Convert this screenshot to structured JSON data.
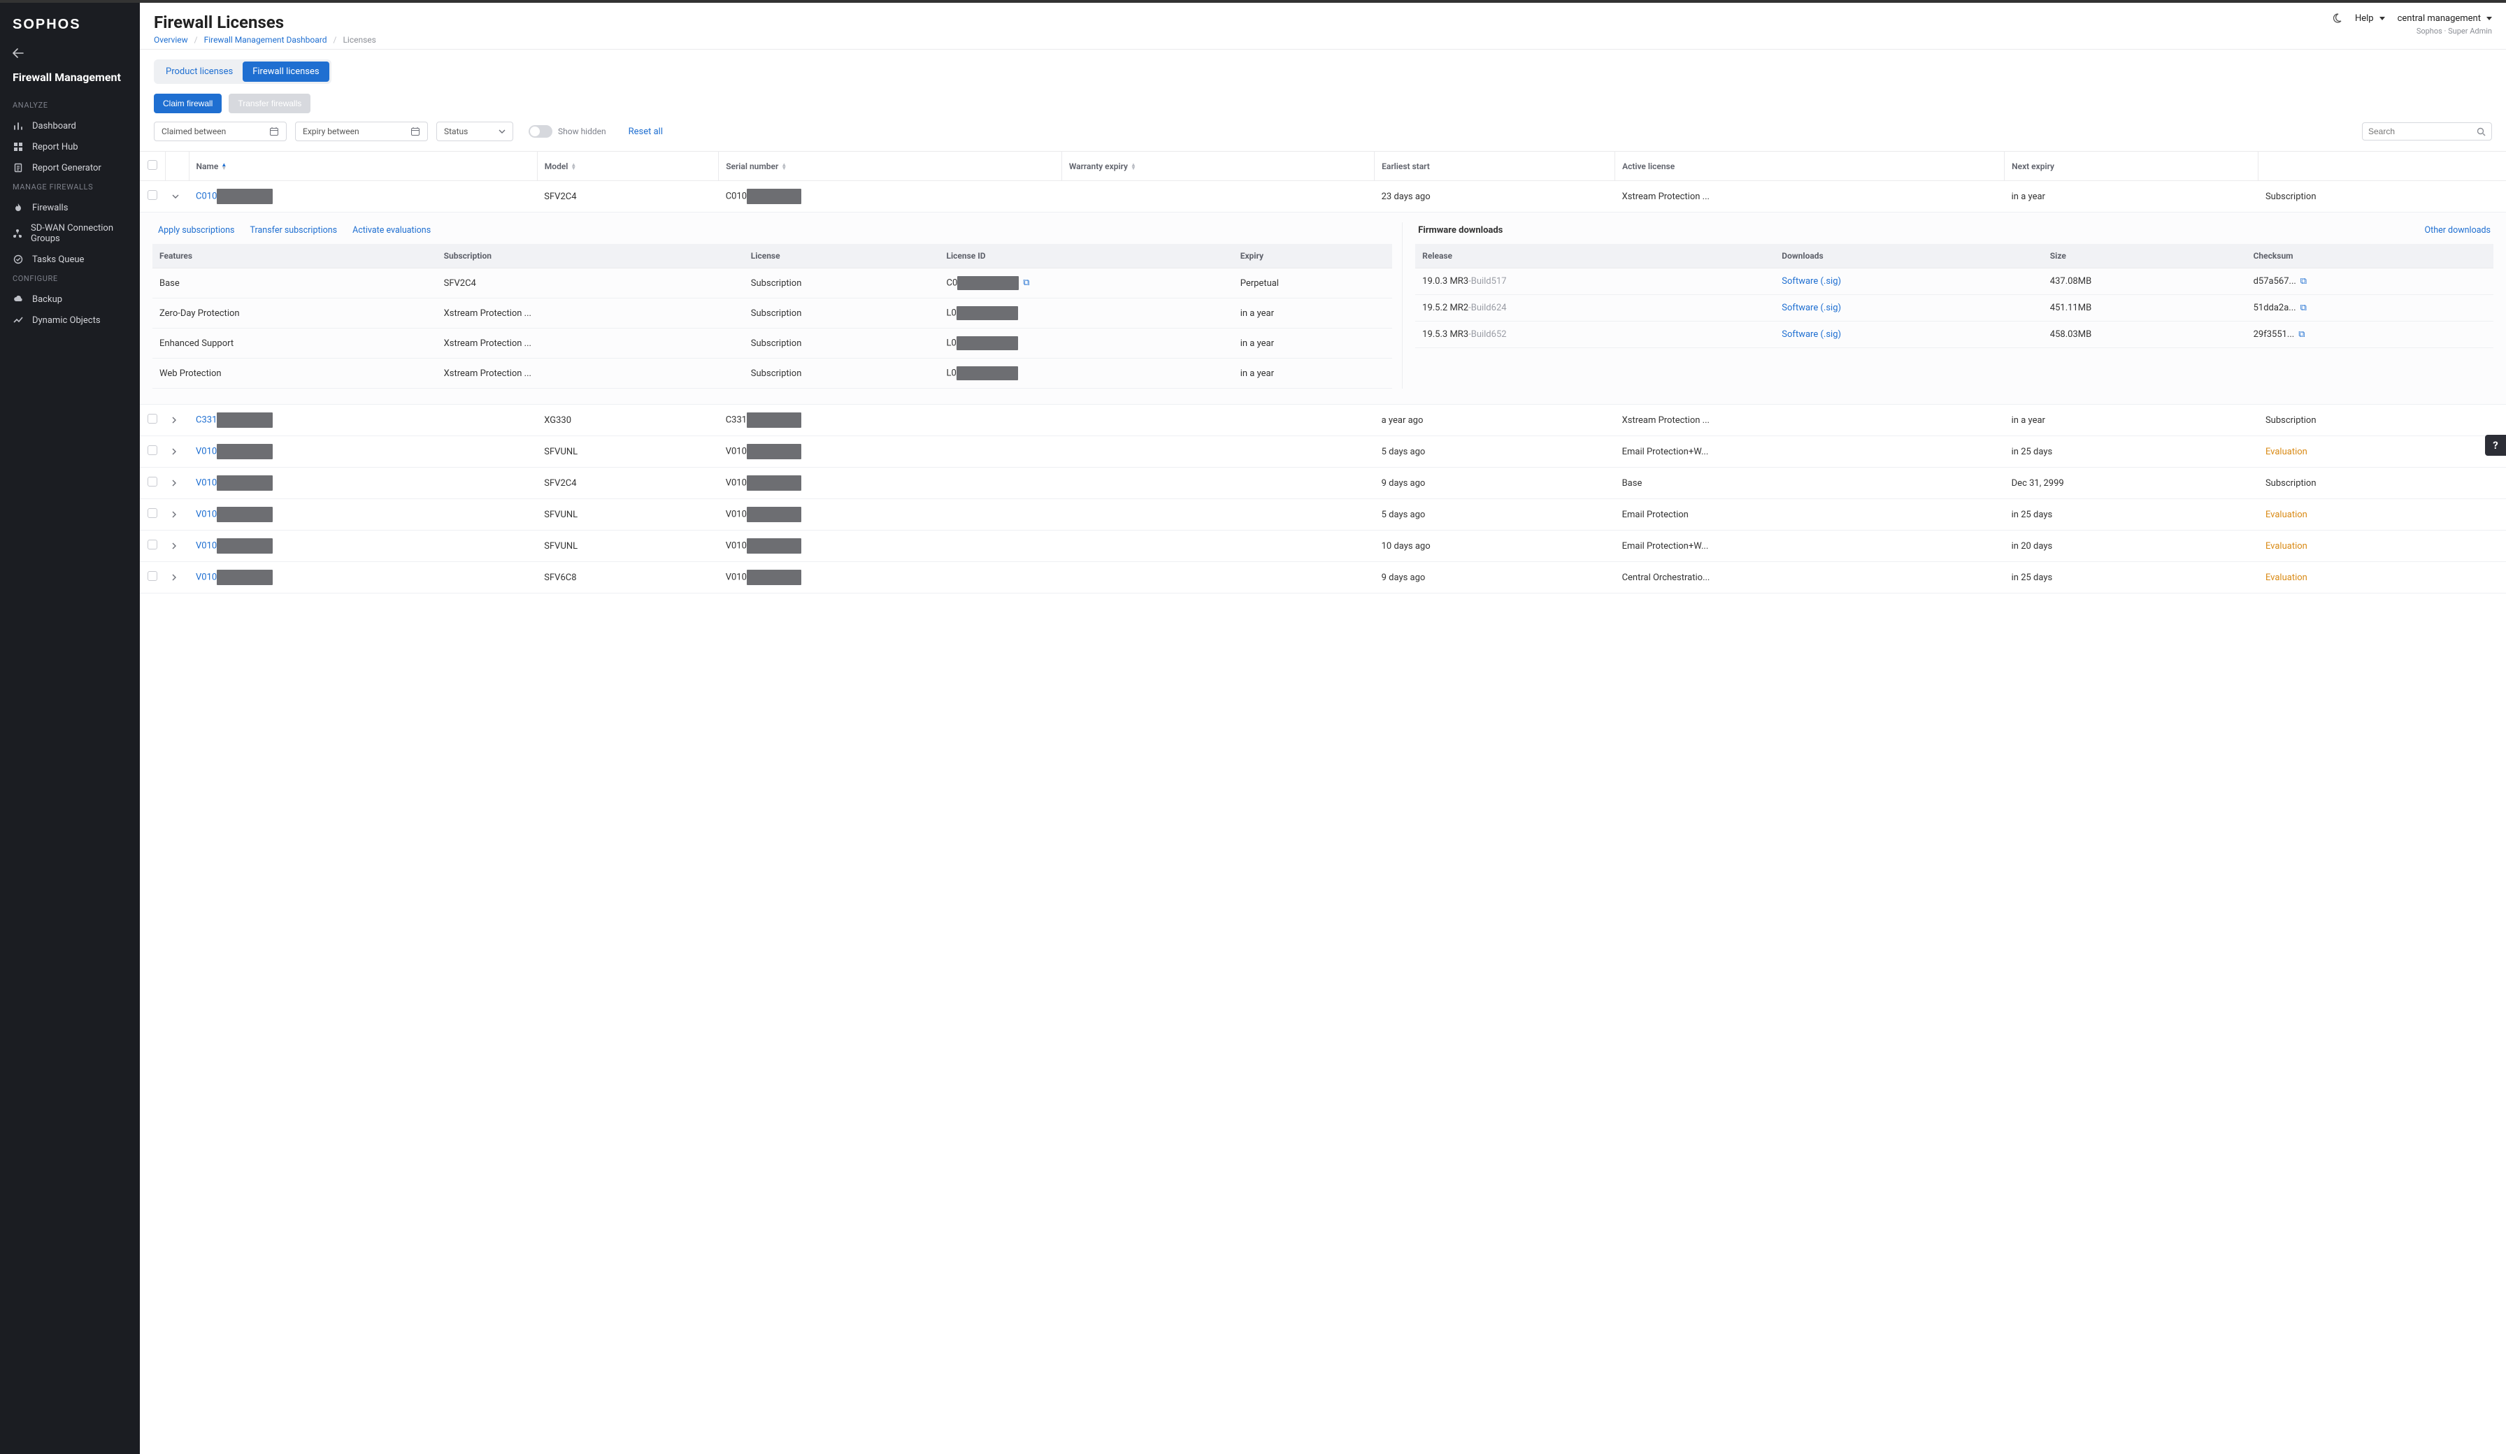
{
  "brand": "SOPHOS",
  "side_title": "Firewall Management",
  "side_groups": [
    {
      "label": "ANALYZE",
      "items": [
        {
          "id": "dashboard",
          "label": "Dashboard",
          "icon": "bars"
        },
        {
          "id": "report-hub",
          "label": "Report Hub",
          "icon": "grid"
        },
        {
          "id": "report-generator",
          "label": "Report Generator",
          "icon": "doc"
        }
      ]
    },
    {
      "label": "MANAGE FIREWALLS",
      "items": [
        {
          "id": "firewalls",
          "label": "Firewalls",
          "icon": "flame"
        },
        {
          "id": "sdwan",
          "label": "SD-WAN Connection Groups",
          "icon": "nodes"
        },
        {
          "id": "tasks",
          "label": "Tasks Queue",
          "icon": "check"
        }
      ]
    },
    {
      "label": "CONFIGURE",
      "items": [
        {
          "id": "backup",
          "label": "Backup",
          "icon": "cloud"
        },
        {
          "id": "dynamic",
          "label": "Dynamic Objects",
          "icon": "trend"
        }
      ]
    }
  ],
  "page_title": "Firewall Licenses",
  "crumbs": {
    "overview": "Overview",
    "dash": "Firewall Management Dashboard",
    "current": "Licenses"
  },
  "header": {
    "help": "Help",
    "account": "central management",
    "tenant": "Sophos · Super Admin"
  },
  "tabs": {
    "product": "Product licenses",
    "firewall": "Firewall licenses"
  },
  "actions": {
    "claim": "Claim firewall",
    "transfer": "Transfer firewalls"
  },
  "filters": {
    "claimed": "Claimed between",
    "expiry": "Expiry between",
    "status": "Status",
    "show_hidden": "Show hidden",
    "reset": "Reset all",
    "search_placeholder": "Search"
  },
  "columns": {
    "name": "Name",
    "model": "Model",
    "serial": "Serial number",
    "warranty": "Warranty expiry",
    "earliest": "Earliest start",
    "active": "Active license",
    "next": "Next expiry",
    "type_blank": ""
  },
  "rows": [
    {
      "expanded": true,
      "name_prefix": "C010",
      "model": "SFV2C4",
      "serial_prefix": "C010",
      "earliest": "23 days ago",
      "active": "Xstream Protection ...",
      "next": "in a year",
      "type": "Subscription"
    },
    {
      "expanded": false,
      "name_prefix": "C331",
      "model": "XG330",
      "serial_prefix": "C331",
      "earliest": "a year ago",
      "active": "Xstream Protection ...",
      "next": "in a year",
      "type": "Subscription"
    },
    {
      "expanded": false,
      "name_prefix": "V010",
      "model": "SFVUNL",
      "serial_prefix": "V010",
      "earliest": "5 days ago",
      "active": "Email Protection+W...",
      "next": "in 25 days",
      "type": "Evaluation"
    },
    {
      "expanded": false,
      "name_prefix": "V010",
      "model": "SFV2C4",
      "serial_prefix": "V010",
      "earliest": "9 days ago",
      "active": "Base",
      "next": "Dec 31, 2999",
      "type": "Subscription"
    },
    {
      "expanded": false,
      "name_prefix": "V010",
      "model": "SFVUNL",
      "serial_prefix": "V010",
      "earliest": "5 days ago",
      "active": "Email Protection",
      "next": "in 25 days",
      "type": "Evaluation"
    },
    {
      "expanded": false,
      "name_prefix": "V010",
      "model": "SFVUNL",
      "serial_prefix": "V010",
      "earliest": "10 days ago",
      "active": "Email Protection+W...",
      "next": "in 20 days",
      "type": "Evaluation"
    },
    {
      "expanded": false,
      "name_prefix": "V010",
      "model": "SFV6C8",
      "serial_prefix": "V010",
      "earliest": "9 days ago",
      "active": "Central Orchestratio...",
      "next": "in 25 days",
      "type": "Evaluation"
    }
  ],
  "panel": {
    "links": {
      "apply": "Apply subscriptions",
      "transfer": "Transfer subscriptions",
      "activate": "Activate evaluations"
    },
    "feat_cols": {
      "features": "Features",
      "subscription": "Subscription",
      "license": "License",
      "license_id": "License ID",
      "expiry": "Expiry"
    },
    "features": [
      {
        "feature": "Base",
        "sub": "SFV2C4",
        "license": "Subscription",
        "lid_prefix": "C0",
        "expiry": "Perpetual"
      },
      {
        "feature": "Zero-Day Protection",
        "sub": "Xstream Protection ...",
        "license": "Subscription",
        "lid_prefix": "L0",
        "expiry": "in a year"
      },
      {
        "feature": "Enhanced Support",
        "sub": "Xstream Protection ...",
        "license": "Subscription",
        "lid_prefix": "L0",
        "expiry": "in a year"
      },
      {
        "feature": "Web Protection",
        "sub": "Xstream Protection ...",
        "license": "Subscription",
        "lid_prefix": "L0",
        "expiry": "in a year"
      }
    ],
    "fw_title": "Firmware downloads",
    "other": "Other downloads",
    "fw_cols": {
      "release": "Release",
      "downloads": "Downloads",
      "size": "Size",
      "checksum": "Checksum"
    },
    "firmware": [
      {
        "release": "19.0.3 MR3",
        "build": "-Build517",
        "dl": "Software (.sig)",
        "size": "437.08MB",
        "checksum": "d57a567..."
      },
      {
        "release": "19.5.2 MR2",
        "build": "-Build624",
        "dl": "Software (.sig)",
        "size": "451.11MB",
        "checksum": "51dda2a..."
      },
      {
        "release": "19.5.3 MR3",
        "build": "-Build652",
        "dl": "Software (.sig)",
        "size": "458.03MB",
        "checksum": "29f3551..."
      }
    ]
  }
}
